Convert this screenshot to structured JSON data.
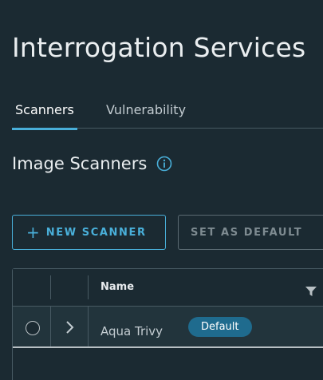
{
  "page": {
    "title": "Interrogation Services"
  },
  "tabs": [
    {
      "label": "Scanners",
      "active": true
    },
    {
      "label": "Vulnerability",
      "active": false
    }
  ],
  "section": {
    "title": "Image Scanners",
    "info_icon": "info-circle-icon"
  },
  "toolbar": {
    "new_scanner_label": "NEW SCANNER",
    "new_scanner_icon": "plus-icon",
    "set_default_label": "SET AS DEFAULT"
  },
  "grid": {
    "columns": [
      "Name"
    ],
    "filter_icon": "filter-icon",
    "rows": [
      {
        "name": "Aqua Trivy",
        "badge": "Default",
        "selected": false
      }
    ]
  },
  "colors": {
    "background": "#1b2a32",
    "accent": "#49afd9",
    "badge": "#1f6b8e",
    "border": "#485a63"
  }
}
